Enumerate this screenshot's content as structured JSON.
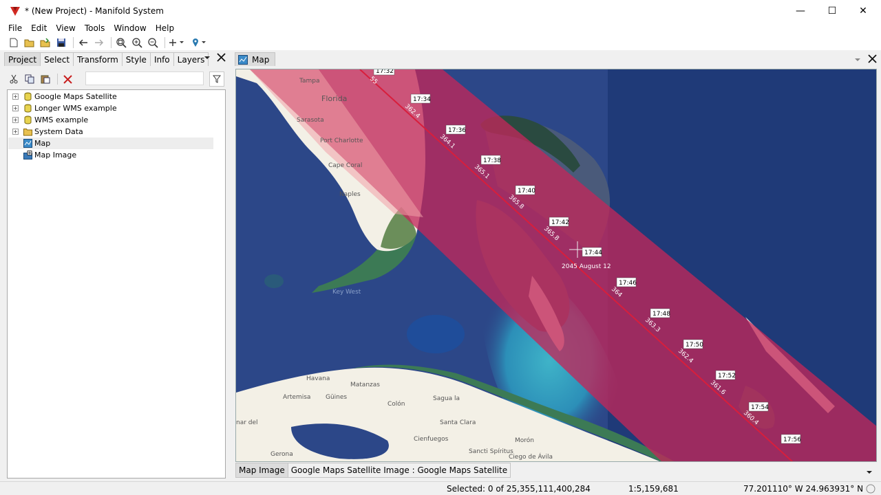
{
  "window": {
    "title": "* (New Project) - Manifold System",
    "minimize": "—",
    "maximize": "☐",
    "close": "✕"
  },
  "menu": [
    "File",
    "Edit",
    "View",
    "Tools",
    "Window",
    "Help"
  ],
  "left_tabs": [
    "Project",
    "Select",
    "Transform",
    "Style",
    "Info",
    "Layers"
  ],
  "tree": [
    {
      "label": "Google Maps Satellite",
      "icon": "database-icon",
      "expandable": true
    },
    {
      "label": "Longer WMS example",
      "icon": "database-icon",
      "expandable": true
    },
    {
      "label": "WMS example",
      "icon": "database-icon",
      "expandable": true
    },
    {
      "label": "System Data",
      "icon": "folder-icon",
      "expandable": true
    },
    {
      "label": "Map",
      "icon": "map-icon",
      "expandable": false
    },
    {
      "label": "Map Image",
      "icon": "image-icon",
      "expandable": false
    }
  ],
  "map_tab": "Map",
  "map_labels": {
    "places": [
      "Tampa",
      "Florida",
      "Sarasota",
      "Port Charlotte",
      "Cape Coral",
      "Naples",
      "Havana",
      "Matanzas",
      "Güines",
      "Artemisa",
      "Colón",
      "Sagua la",
      "Santa Clara",
      "Cienfuegos",
      "Morón",
      "Sancti Spíritus",
      "Ciego de Ávila",
      "Key West",
      "Gerona",
      "nar del"
    ],
    "times": [
      "17:32",
      "17:34",
      "17:36",
      "17:38",
      "17:40",
      "17:42",
      "17:44",
      "17:46",
      "17:48",
      "17:50",
      "17:52",
      "17:54",
      "17:56"
    ],
    "path_values": [
      "55",
      "362.4",
      "364.1",
      "365.1",
      "365.8",
      "365.8",
      "365.8",
      "364",
      "363.3",
      "362.4",
      "361.6",
      "360.4"
    ],
    "date_label": "2045 August 12"
  },
  "layer_tabs": [
    "Map Image",
    "Google Maps Satellite Image : Google Maps Satellite"
  ],
  "status": {
    "selected": "Selected: 0 of 25,355,111,400,284",
    "scale": "1:5,159,681",
    "coords": "77.201110° W 24.963931° N"
  },
  "colors": {
    "eclipse_band": "#c0285a",
    "center_line": "#d81e3c",
    "ocean": "#2c4788",
    "land": "#f3f0e6"
  }
}
